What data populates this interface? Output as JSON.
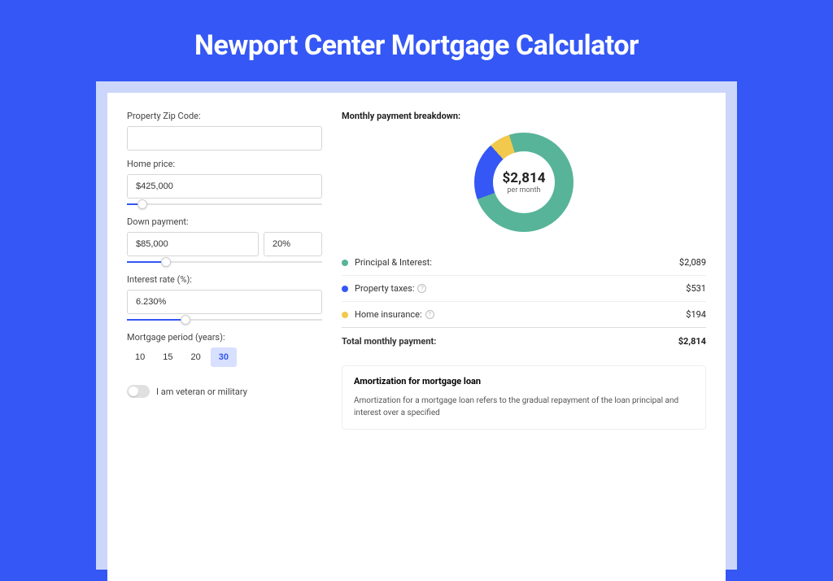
{
  "title": "Newport Center Mortgage Calculator",
  "form": {
    "zip": {
      "label": "Property Zip Code:",
      "value": ""
    },
    "home_price": {
      "label": "Home price:",
      "value": "$425,000",
      "slider_pct": 8
    },
    "down_payment": {
      "label": "Down payment:",
      "value": "$85,000",
      "pct": "20%",
      "slider_pct": 20
    },
    "interest": {
      "label": "Interest rate (%):",
      "value": "6.230%",
      "slider_pct": 30
    },
    "period": {
      "label": "Mortgage period (years):",
      "options": [
        "10",
        "15",
        "20",
        "30"
      ],
      "active": "30"
    },
    "veteran": {
      "label": "I am veteran or military",
      "on": false
    }
  },
  "breakdown": {
    "title": "Monthly payment breakdown:",
    "donut": {
      "amount": "$2,814",
      "sub": "per month"
    },
    "lines": [
      {
        "color": "g",
        "label": "Principal & Interest:",
        "value": "$2,089",
        "help": false
      },
      {
        "color": "b",
        "label": "Property taxes:",
        "value": "$531",
        "help": true
      },
      {
        "color": "y",
        "label": "Home insurance:",
        "value": "$194",
        "help": true
      }
    ],
    "total": {
      "label": "Total monthly payment:",
      "value": "$2,814"
    }
  },
  "amortization": {
    "title": "Amortization for mortgage loan",
    "text": "Amortization for a mortgage loan refers to the gradual repayment of the loan principal and interest over a specified"
  },
  "chart_data": {
    "type": "pie",
    "title": "Monthly payment breakdown",
    "categories": [
      "Principal & Interest",
      "Property taxes",
      "Home insurance"
    ],
    "values": [
      2089,
      531,
      194
    ],
    "colors": [
      "#57b499",
      "#3457f5",
      "#f2c94c"
    ],
    "total": 2814,
    "center_label": "$2,814 per month"
  }
}
